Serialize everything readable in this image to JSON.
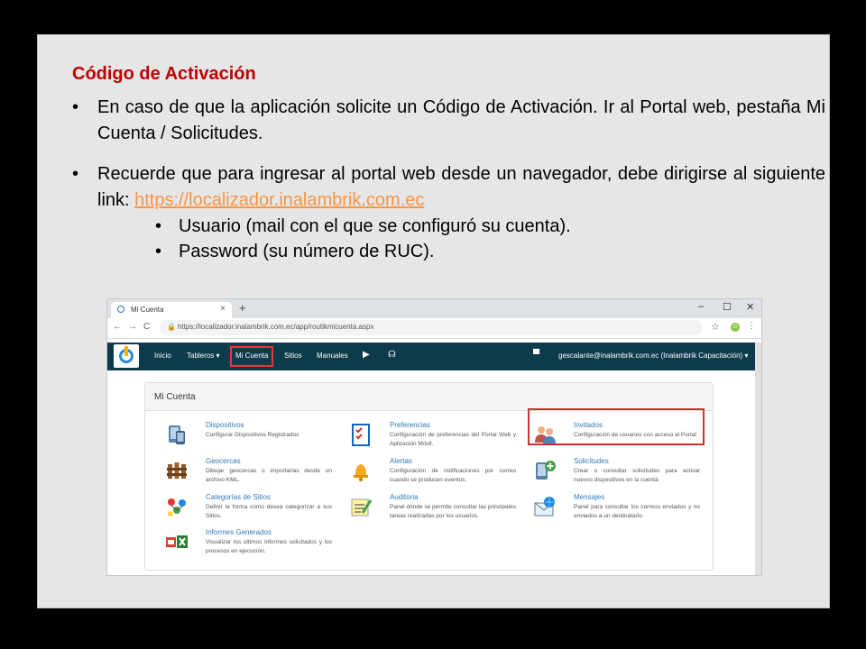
{
  "slide": {
    "title": "Código de Activación",
    "bullet_glyph": "•",
    "bullets": [
      {
        "text": "En caso de que la aplicación solicite un Código de Activación. Ir al Portal web, pestaña Mi Cuenta / Solicitudes."
      },
      {
        "text_before": "Recuerde que para ingresar al portal web desde un navegador, debe dirigirse al siguiente link: ",
        "link": "https://localizador.inalambrik.com.ec"
      }
    ],
    "sub_bullets": [
      "Usuario (mail con el que se configuró su cuenta).",
      "Password (su número de RUC)."
    ]
  },
  "browser": {
    "tab_title": "Mi Cuenta",
    "tab_close": "×",
    "new_tab": "+",
    "win_min": "–",
    "win_max": "☐",
    "win_close": "✕",
    "back": "←",
    "forward": "→",
    "reload": "C",
    "lock": "🔒",
    "url": "https://localizador.inalambrik.com.ec/app/routikmicuenta.aspx",
    "star": "☆",
    "profile": "G",
    "kebab": "⋮"
  },
  "app": {
    "nav": [
      {
        "label": "Inicio"
      },
      {
        "label": "Tableros ▾"
      },
      {
        "label": "Mi Cuenta"
      },
      {
        "label": "Sitios"
      },
      {
        "label": "Manuales"
      }
    ],
    "youtube_icon": "▶",
    "support_icon": "☊",
    "chat_icon": "▀",
    "user": "gescalante@inalambrik.com.ec (Inalambrik Capacitación) ▾",
    "panel_title": "Mi Cuenta",
    "items": [
      {
        "name": "Dispositivos",
        "desc": "Configurar Dispositivos Registrados",
        "icon": "devices-icon"
      },
      {
        "name": "Preferencias",
        "desc": "Configuración de preferencias del Portal Web y Aplicación Móvil.",
        "icon": "checklist-icon"
      },
      {
        "name": "Invitados",
        "desc": "Configuración de usuarios con acceso al Portal",
        "icon": "users-icon"
      },
      {
        "name": "Geocercas",
        "desc": "Dibujar geocercas o importarlas desde un archivo KML.",
        "icon": "geofence-icon"
      },
      {
        "name": "Alertas",
        "desc": "Configuración de notificaciones por correo cuando se producen eventos.",
        "icon": "bell-icon"
      },
      {
        "name": "Solicitudes",
        "desc": "Crear o consultar solicitudes para activar nuevos dispositivos en la cuenta",
        "icon": "add-device-icon"
      },
      {
        "name": "Categorías de Sitios",
        "desc": "Definir la forma como desea categorizar a sus Sitios.",
        "icon": "categories-icon"
      },
      {
        "name": "Auditoria",
        "desc": "Panel donde se permite consultar las principales tareas realizadas por los usuarios.",
        "icon": "audit-icon"
      },
      {
        "name": "Mensajes",
        "desc": "Panel para consultar los correos enviados y no enviados a un destinatario.",
        "icon": "messages-icon"
      },
      {
        "name": "Informes Generados",
        "desc": "Visualizar los ultimos informes solicitados y los procesos en ejecución.",
        "icon": "reports-icon"
      }
    ]
  },
  "colors": {
    "title": "#c00000",
    "link": "#f79646",
    "app_nav": "#0d3b4b",
    "highlight": "#d32f2f",
    "item_link": "#337ab7"
  }
}
